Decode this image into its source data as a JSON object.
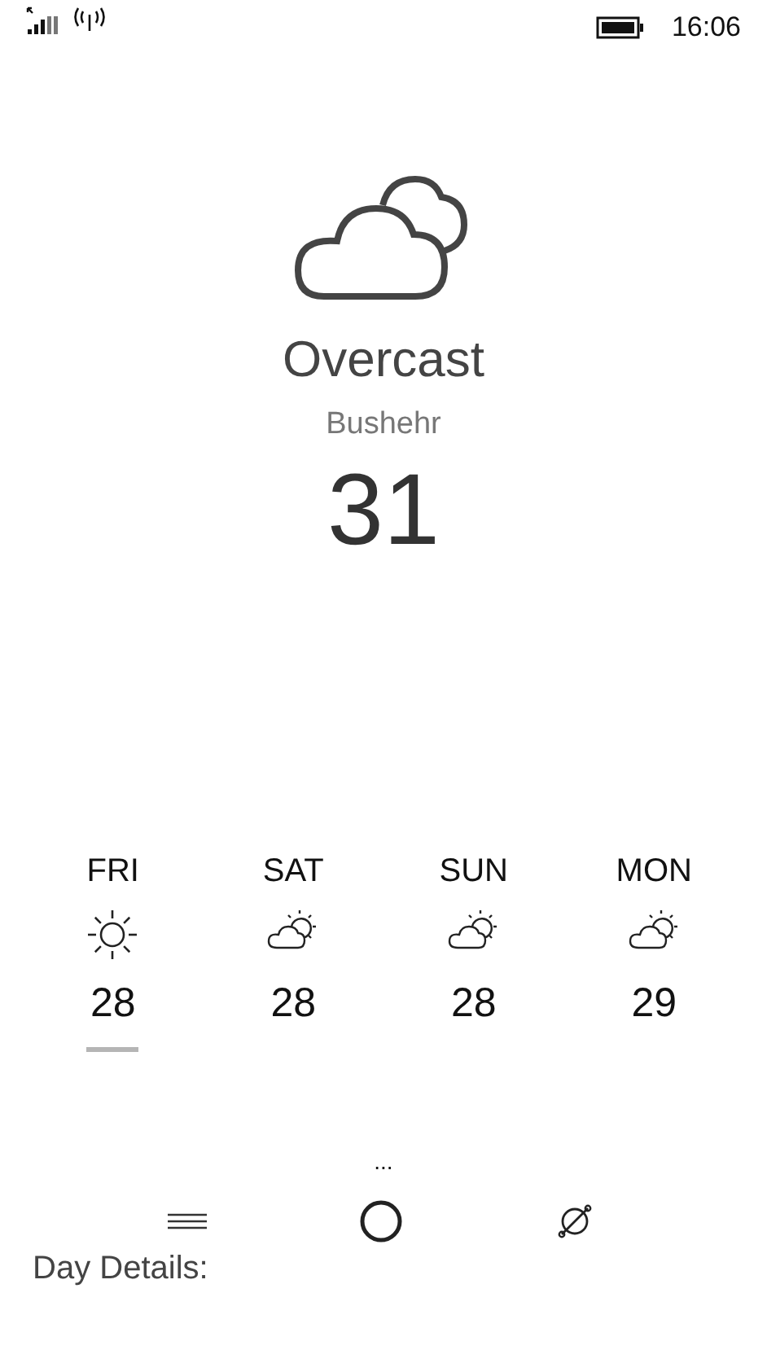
{
  "status_bar": {
    "time": "16:06"
  },
  "current": {
    "condition": "Overcast",
    "city": "Bushehr",
    "temperature": "31"
  },
  "forecast": [
    {
      "day": "FRI",
      "kind": "sunny",
      "temperature": "28",
      "selected": true
    },
    {
      "day": "SAT",
      "kind": "partly-cloudy",
      "temperature": "28",
      "selected": false
    },
    {
      "day": "SUN",
      "kind": "partly-cloudy",
      "temperature": "28",
      "selected": false
    },
    {
      "day": "MON",
      "kind": "partly-cloudy",
      "temperature": "29",
      "selected": false
    }
  ],
  "app_bar": {
    "more": "...",
    "section_label": "Day Details:"
  }
}
